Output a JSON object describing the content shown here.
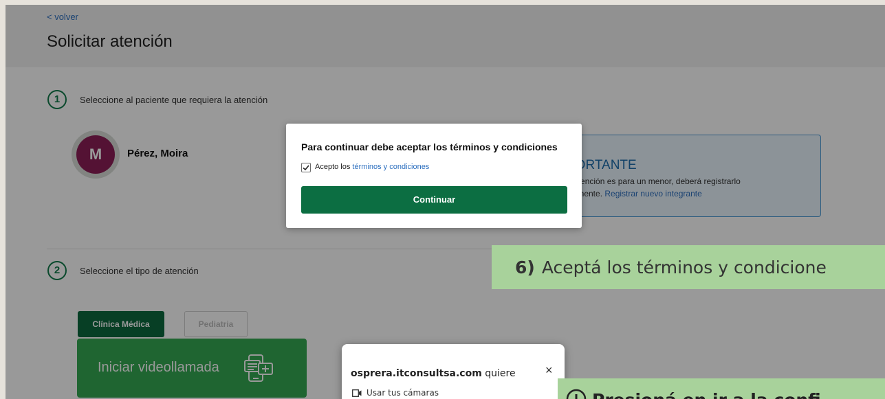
{
  "header": {
    "back_label": "< volver",
    "title": "Solicitar atención"
  },
  "step1": {
    "number": "1",
    "label": "Seleccione al paciente que requiera la atención"
  },
  "patient": {
    "initial": "M",
    "name": "Pérez, Moira"
  },
  "info_box": {
    "title": "PORTANTE",
    "line1": "a atención es para un menor, deberá registrarlo",
    "line2_prefix": "viamente. ",
    "line2_link": "Registrar nuevo integrante"
  },
  "step2": {
    "number": "2",
    "label": "Seleccione el tipo de atención"
  },
  "tabs": [
    {
      "label": "Clínica Médica",
      "active": true
    },
    {
      "label": "Pediatria",
      "active": false
    }
  ],
  "video_button": {
    "label": "Iniciar videollamada"
  },
  "terms_modal": {
    "title": "Para continuar debe aceptar los términos y condiciones",
    "checkbox_prefix": "Acepto los ",
    "checkbox_link": "términos y condiciones",
    "checked": true,
    "continue_label": "Continuar"
  },
  "callout": {
    "number": "6)",
    "text": "Aceptá los términos y condicione"
  },
  "permission_popup": {
    "domain": "osprera.itconsultsa.com",
    "suffix": " quiere",
    "close": "×",
    "item": "Usar tus cámaras"
  },
  "callout2": {
    "text": "Presioná en ir a la confi"
  },
  "colors": {
    "primary_green": "#0c6a3f",
    "video_green": "#34a853",
    "callout_green": "#a8d29b",
    "avatar": "#8c1f57",
    "link_blue": "#2c6fbf"
  }
}
